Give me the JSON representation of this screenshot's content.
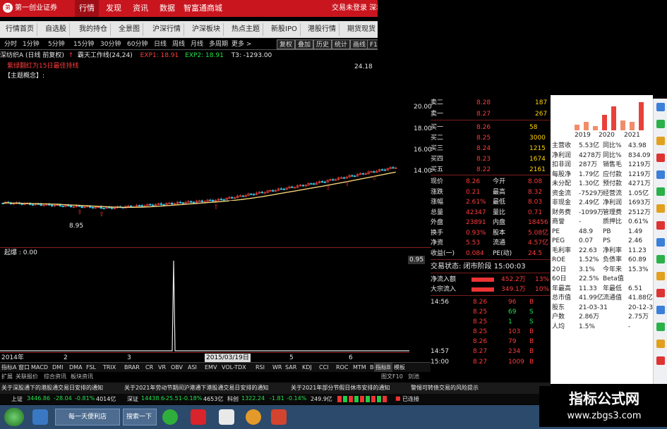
{
  "topbar": {
    "logo": "第一创业证券",
    "menus": [
      "行情",
      "发现",
      "资讯",
      "数据",
      "智富通商城"
    ],
    "login": "交易未登录 深圳"
  },
  "nav": {
    "tabs": [
      "行情首页",
      "自选股",
      "我的持仓",
      "全景图",
      "沪深行情",
      "沪深板块",
      "热点主题",
      "新股IPO",
      "港股行情",
      "期货现货"
    ]
  },
  "period": {
    "items": [
      "分时",
      "1分钟",
      "5分钟",
      "15分钟",
      "30分钟",
      "60分钟",
      "日线",
      "周线",
      "月线",
      "多周期",
      "更多 >"
    ],
    "buttons": [
      "复权",
      "叠加",
      "历史",
      "统计",
      "画线",
      "F10"
    ]
  },
  "chart": {
    "stock": "深纺织A (日线 前复权)",
    "indicator": "霸天工作线(24,24)",
    "exp1": "EXP1: 18.91",
    "exp2": "EXP2: 18.91",
    "t3": "T3: -1293.00",
    "warn": "紫绿翻红为15日最佳持线",
    "concept": "【主题概念】:",
    "price_high": "24.18",
    "price_low": "8.95",
    "sub_name": "起爆 : 0.00",
    "sub_val": "0.95",
    "y_ticks": [
      "20.00",
      "18.00",
      "16.00",
      "14.00",
      "12.00"
    ],
    "date_left": "2014年",
    "date_mid": "2015/03/19日",
    "date_ticks": [
      "2",
      "3",
      "4",
      "5",
      "6"
    ]
  },
  "quote": {
    "asks": [
      [
        "卖二",
        "8.28",
        "187"
      ],
      [
        "卖一",
        "8.27",
        "267"
      ]
    ],
    "bids": [
      [
        "买一",
        "8.26",
        "58"
      ],
      [
        "买二",
        "8.25",
        "3000"
      ],
      [
        "买三",
        "8.24",
        "1215"
      ],
      [
        "买四",
        "8.23",
        "1674"
      ],
      [
        "买五",
        "8.22",
        "2161"
      ]
    ],
    "stats": [
      [
        "现价",
        "8.26",
        "今开",
        "8.08"
      ],
      [
        "涨跌",
        "0.21",
        "最高",
        "8.32"
      ],
      [
        "涨幅",
        "2.61%",
        "最低",
        "8.03"
      ],
      [
        "总量",
        "42347",
        "量比",
        "0.71"
      ],
      [
        "外盘",
        "23891",
        "内盘",
        "18456"
      ],
      [
        "换手",
        "0.93%",
        "股本",
        "5.08亿"
      ],
      [
        "净资",
        "5.53",
        "流通",
        "4.57亿"
      ],
      [
        "收益(一)",
        "0.084",
        "PE(动)",
        "24.5"
      ]
    ],
    "status": "交易状态: 闭市阶段 15:00:03",
    "flow": [
      [
        "净流入额",
        "452.2万",
        "13%"
      ],
      [
        "大宗流入",
        "349.1万",
        "10%"
      ]
    ],
    "ticks": [
      [
        "14:56",
        "8.26",
        "96",
        "B"
      ],
      [
        "",
        "8.25",
        "69",
        "S"
      ],
      [
        "",
        "8.25",
        "1",
        "S"
      ],
      [
        "",
        "8.25",
        "103",
        "B"
      ],
      [
        "",
        "8.26",
        "79",
        "B"
      ],
      [
        "14:57",
        "8.27",
        "234",
        "B"
      ],
      [
        "15:00",
        "8.27",
        "1009",
        "B"
      ]
    ]
  },
  "finance": {
    "years": [
      "2019",
      "2020",
      "2021"
    ],
    "rows": [
      [
        "主营收",
        "5.53亿",
        "同比%",
        "43.98"
      ],
      [
        "净利润",
        "4278万",
        "同比%",
        "834.09"
      ],
      [
        "扣非润",
        "287万",
        "销售毛",
        "1219万"
      ],
      [
        "每股净",
        "1.79亿",
        "应付款",
        "1219万"
      ],
      [
        "未分配",
        "1.30亿",
        "预付款",
        "4271万"
      ],
      [
        "资金流",
        "-7529万",
        "经营流",
        "1.05亿"
      ],
      [
        "非现金",
        "2.49亿",
        "净利润",
        "1693万"
      ],
      [
        "财务费",
        "-1099万",
        "管理费",
        "2512万"
      ],
      [
        "商誉",
        "-",
        "质押比",
        "0.61%"
      ],
      [
        "PE",
        "48.9",
        "PB",
        "1.49"
      ],
      [
        "PEG",
        "0.07",
        "PS",
        "2.46"
      ],
      [
        "毛利率",
        "22.63",
        "净利率",
        "11.23"
      ],
      [
        "ROE",
        "1.52%",
        "负债率",
        "60.89"
      ],
      [
        "20日",
        "3.1%",
        "今年来",
        "15.3%"
      ],
      [
        "60日",
        "22.5%",
        "Beta值",
        ""
      ],
      [
        "年最高",
        "11.33",
        "年最低",
        "6.51"
      ],
      [
        "总市值",
        "41.99亿",
        "流通值",
        "41.88亿"
      ],
      [
        "股东",
        "21-03-31",
        "",
        "20-12-31"
      ],
      [
        "户数",
        "2.86万",
        "",
        "2.75万"
      ],
      [
        "人均",
        "1.5%",
        "",
        "-"
      ]
    ]
  },
  "indicators": [
    "指标A",
    "窗口",
    "MACD",
    "DMI",
    "DMA",
    "FSL",
    "TRIX",
    "BRAR",
    "CR",
    "VR",
    "OBV",
    "ASI",
    "EMV",
    "VOL-TDX",
    "RSI",
    "WR",
    "SAR",
    "KDJ",
    "CCI",
    "ROC",
    "MTM",
    "BOLL"
  ],
  "subtabs": [
    "扩展",
    "关联报价",
    "综合资讯",
    "板块资讯"
  ],
  "rightsub": [
    "指标B",
    "模板",
    "日线",
    "图文F10",
    "剑池"
  ],
  "news": [
    "关于深股通下的港股通交易日安排的通知",
    "关于2021年劳动节期间沪港通下港股通交易日安排的通知",
    "关于2021年部分节假日休市安排的通知",
    "警惕可转债交易的风险提示"
  ],
  "index": {
    "sh": [
      "上证",
      "3446.86",
      "-28.04",
      "-0.81%",
      "4014亿"
    ],
    "sz": [
      "深证",
      "14438.6",
      "-25.51",
      "-0.18%",
      "4653亿"
    ],
    "kc": [
      "科创",
      "1322.24",
      "-1.81",
      "-0.14%",
      "249.9亿"
    ],
    "conn": "已连接"
  },
  "taskbar": {
    "ie": "每一天便利店",
    "search": "搜索一下"
  },
  "watermark": {
    "cn": "指标公式网",
    "url": "www.zbgs3.com"
  },
  "colors": {
    "up": "#ff3b3b",
    "down": "#22e04a",
    "ma": "#f2d27a",
    "bar_up": "#e8413a",
    "bar_down": "#35c6e8"
  }
}
